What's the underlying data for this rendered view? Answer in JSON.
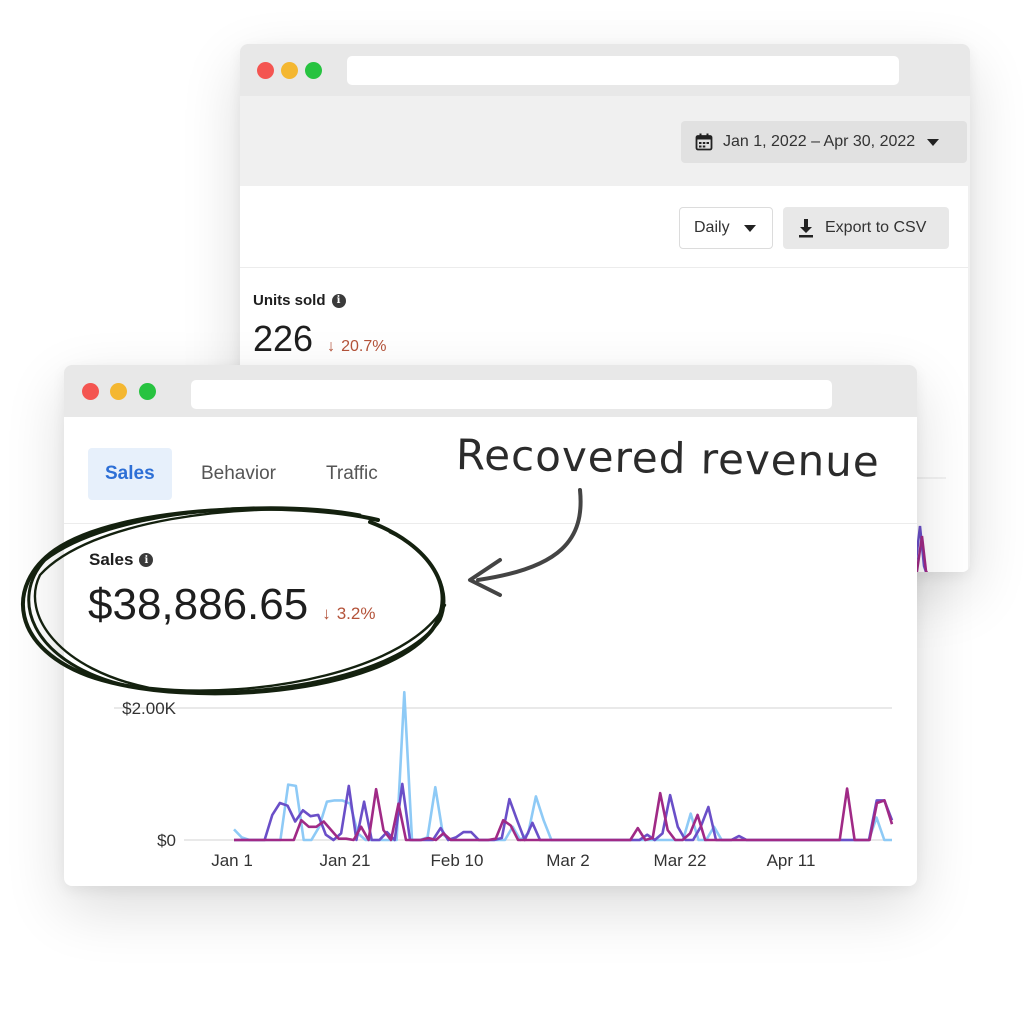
{
  "back_window": {
    "date_range": "Jan 1, 2022 – Apr 30, 2022",
    "interval_select": "Daily",
    "export_button": "Export to CSV",
    "metric": {
      "label": "Units sold",
      "value": "226",
      "delta_arrow": "↓",
      "delta": "20.7%"
    }
  },
  "front_window": {
    "tabs": [
      {
        "label": "Sales",
        "active": true
      },
      {
        "label": "Behavior",
        "active": false
      },
      {
        "label": "Traffic",
        "active": false
      }
    ],
    "metric": {
      "label": "Sales",
      "value": "$38,886.65",
      "delta_arrow": "↓",
      "delta": "3.2%"
    }
  },
  "annotation": {
    "text": "Recovered revenue"
  },
  "colors": {
    "series_purple": "#6a4fc8",
    "series_magenta": "#a02a86",
    "series_lightblue": "#8ecaf6",
    "delta_red": "#b4533a",
    "active_tab": "#2d6fd6"
  },
  "chart_data": {
    "type": "line",
    "x_tick_labels": [
      "Jan 1",
      "Jan 21",
      "Feb 10",
      "Mar 2",
      "Mar 22",
      "Apr 11"
    ],
    "y_tick_labels": [
      "$0",
      "$2.00K"
    ],
    "ylim": [
      0,
      2000
    ],
    "series": [
      {
        "values": [
          0,
          0,
          0,
          0,
          0,
          380,
          560,
          520,
          280,
          450,
          360,
          380,
          80,
          0,
          100,
          820,
          0,
          580,
          0,
          0,
          120,
          0,
          850,
          0,
          0,
          0,
          0,
          180,
          0,
          40,
          120,
          120,
          0,
          0,
          0,
          30,
          620,
          300,
          0,
          260,
          0,
          0,
          0,
          0,
          0,
          0,
          0,
          0,
          0,
          0,
          0,
          0,
          0,
          0,
          80,
          0,
          100,
          680,
          200,
          0,
          0,
          200,
          500,
          0,
          0,
          0,
          60,
          0,
          0,
          0,
          0,
          0,
          0,
          0,
          0,
          0,
          0,
          0,
          0,
          0,
          0,
          0,
          0,
          0,
          600,
          600,
          300
        ]
      },
      {
        "values": [
          0,
          0,
          0,
          0,
          0,
          0,
          0,
          0,
          0,
          300,
          200,
          200,
          280,
          150,
          20,
          20,
          0,
          200,
          0,
          770,
          150,
          0,
          550,
          0,
          0,
          0,
          30,
          0,
          100,
          0,
          0,
          0,
          0,
          0,
          0,
          20,
          300,
          220,
          0,
          0,
          0,
          0,
          0,
          0,
          0,
          0,
          0,
          0,
          0,
          0,
          0,
          0,
          0,
          0,
          180,
          0,
          30,
          710,
          150,
          0,
          0,
          100,
          380,
          0,
          0,
          0,
          0,
          0,
          0,
          0,
          0,
          0,
          0,
          0,
          0,
          0,
          0,
          0,
          0,
          0,
          0,
          0,
          780,
          0,
          0,
          0,
          560,
          600,
          240
        ]
      },
      {
        "values": [
          160,
          40,
          0,
          0,
          0,
          0,
          0,
          840,
          820,
          0,
          0,
          200,
          580,
          600,
          600,
          550,
          100,
          0,
          0,
          0,
          0,
          0,
          2240,
          0,
          0,
          40,
          800,
          80,
          0,
          0,
          0,
          0,
          0,
          0,
          0,
          0,
          200,
          0,
          100,
          660,
          300,
          0,
          0,
          0,
          0,
          0,
          0,
          0,
          0,
          0,
          0,
          0,
          0,
          0,
          0,
          0,
          0,
          0,
          0,
          400,
          0,
          0,
          200,
          0,
          0,
          0,
          0,
          0,
          0,
          0,
          0,
          0,
          0,
          0,
          0,
          0,
          0,
          0,
          0,
          0,
          0,
          0,
          0,
          340,
          0,
          0
        ]
      }
    ]
  }
}
